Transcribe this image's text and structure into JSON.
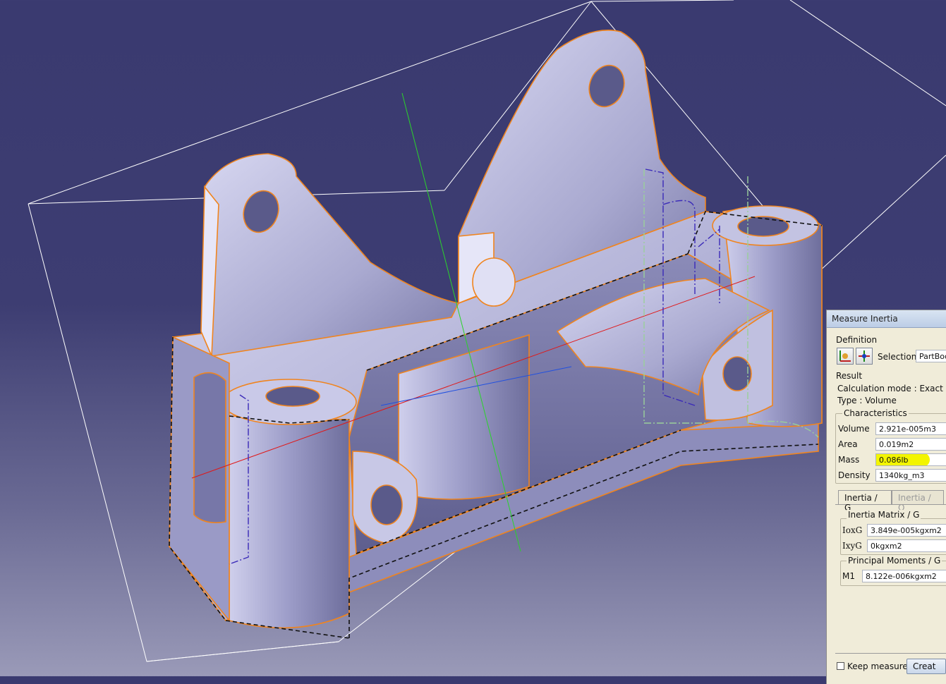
{
  "panel": {
    "title": "Measure Inertia",
    "definition_label": "Definition",
    "selection_label": "Selection :",
    "selection_value": "PartBoc",
    "result_label": "Result",
    "calc_mode": "Calculation mode :  Exact",
    "type": "Type :  Volume",
    "characteristics_label": "Characteristics",
    "volume_label": "Volume",
    "volume_value": "2.921e-005m3",
    "area_label": "Area",
    "area_value": "0.019m2",
    "mass_label": "Mass",
    "mass_value": "0.086lb",
    "density_label": "Density",
    "density_value": "1340kg_m3",
    "tab_inertia_g": "Inertia / G",
    "tab_inertia_o": "Inertia / O",
    "inertia_matrix_label": "Inertia Matrix / G",
    "ioxg_label": "IoxG",
    "ioxg_value": "3.849e-005kgxm2",
    "ixyg_label": "IxyG",
    "ixyg_value": "0kgxm2",
    "principal_label": "Principal Moments / G",
    "m1_label": "M1",
    "m1_value": "8.122e-006kgxm2",
    "keep_measure": "Keep measure",
    "create_button": "Creat"
  },
  "colors": {
    "edge": "#f0841e",
    "part_fill": "#b4b4d8",
    "highlight": "#f3f500",
    "background_top": "#3a3a70"
  },
  "icons": {
    "inertia_icon_1": "inertia-axes-icon",
    "inertia_icon_2": "inertia-point-icon"
  }
}
